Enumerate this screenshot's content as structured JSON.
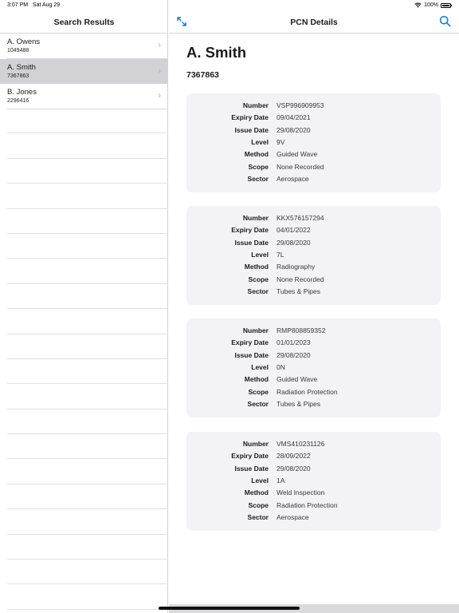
{
  "status_bar": {
    "time": "3:07 PM",
    "date": "Sat Aug 29",
    "battery": "100%",
    "battery_level": 1.0
  },
  "sidebar": {
    "title": "Search Results",
    "results": [
      {
        "name": "A. Owens",
        "id": "1049488",
        "selected": false
      },
      {
        "name": "A. Smith",
        "id": "7367863",
        "selected": true
      },
      {
        "name": "B. Jones",
        "id": "2296416",
        "selected": false
      }
    ]
  },
  "detail": {
    "title": "PCN Details",
    "person_name": "A. Smith",
    "person_id": "7367863",
    "labels": {
      "number": "Number",
      "expiry": "Expiry Date",
      "issue": "Issue Date",
      "level": "Level",
      "method": "Method",
      "scope": "Scope",
      "sector": "Sector"
    },
    "certificates": [
      {
        "number": "VSP996909953",
        "expiry": "09/04/2021",
        "issue": "29/08/2020",
        "level": "9V",
        "method": "Guided Wave",
        "scope": "None Recorded",
        "sector": "Aerospace"
      },
      {
        "number": "KKX576157294",
        "expiry": "04/01/2022",
        "issue": "29/08/2020",
        "level": "7L",
        "method": "Radiography",
        "scope": "None Recorded",
        "sector": "Tubes & Pipes"
      },
      {
        "number": "RMP808859352",
        "expiry": "01/01/2023",
        "issue": "29/08/2020",
        "level": "0N",
        "method": "Guided Wave",
        "scope": "Radiation Protection",
        "sector": "Tubes & Pipes"
      },
      {
        "number": "VMS410231126",
        "expiry": "28/09/2022",
        "issue": "29/08/2020",
        "level": "1A",
        "method": "Weld Inspection",
        "scope": "Radiation Protection",
        "sector": "Aerospace"
      }
    ]
  },
  "icons": {
    "expand": "expand-arrows-icon",
    "search": "search-icon",
    "wifi": "wifi-icon",
    "battery": "battery-icon",
    "chevron": "chevron-right-icon"
  },
  "colors": {
    "accent": "#1a7fd1",
    "selected_row": "#d1d1d6",
    "card_bg": "#f2f2f7"
  }
}
